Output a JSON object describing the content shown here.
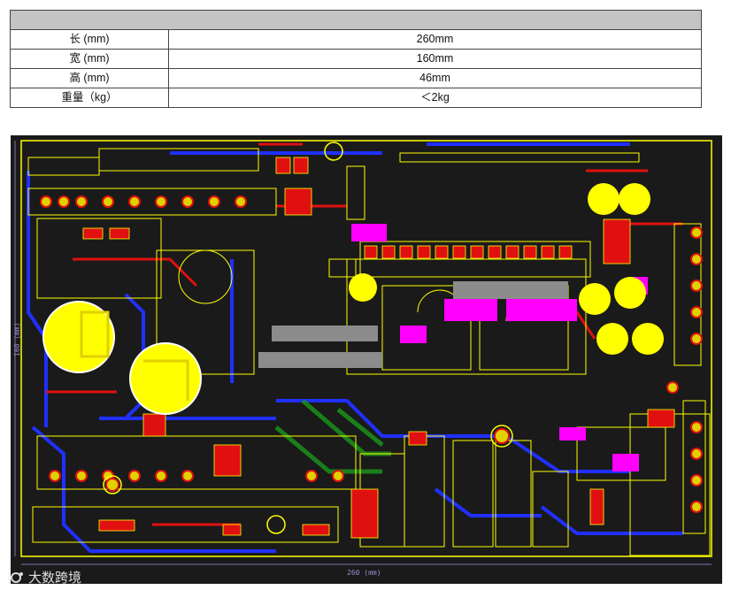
{
  "spec_table": {
    "header": "",
    "rows": [
      {
        "key": "长 (mm)",
        "value": "260mm"
      },
      {
        "key": "宽 (mm)",
        "value": "160mm"
      },
      {
        "key": "高 (mm)",
        "value": "46mm"
      },
      {
        "key": "重量（kg）",
        "value": "＜2kg"
      }
    ]
  },
  "pcb_layout": {
    "bottom_dimension": "260 (mm)",
    "left_dimension": "160 (mm)"
  },
  "watermark": {
    "text": "大数跨境",
    "logo": "bigdata-cross-border-logo"
  },
  "colors": {
    "board_background": "#1a1a1a",
    "silkscreen": "#ffff00",
    "top_copper": "#ff0000",
    "bottom_copper": "#2020ff",
    "pads": "#ff00ff",
    "inner_layer": "#00aa00",
    "table_header": "#c4c4c4"
  }
}
